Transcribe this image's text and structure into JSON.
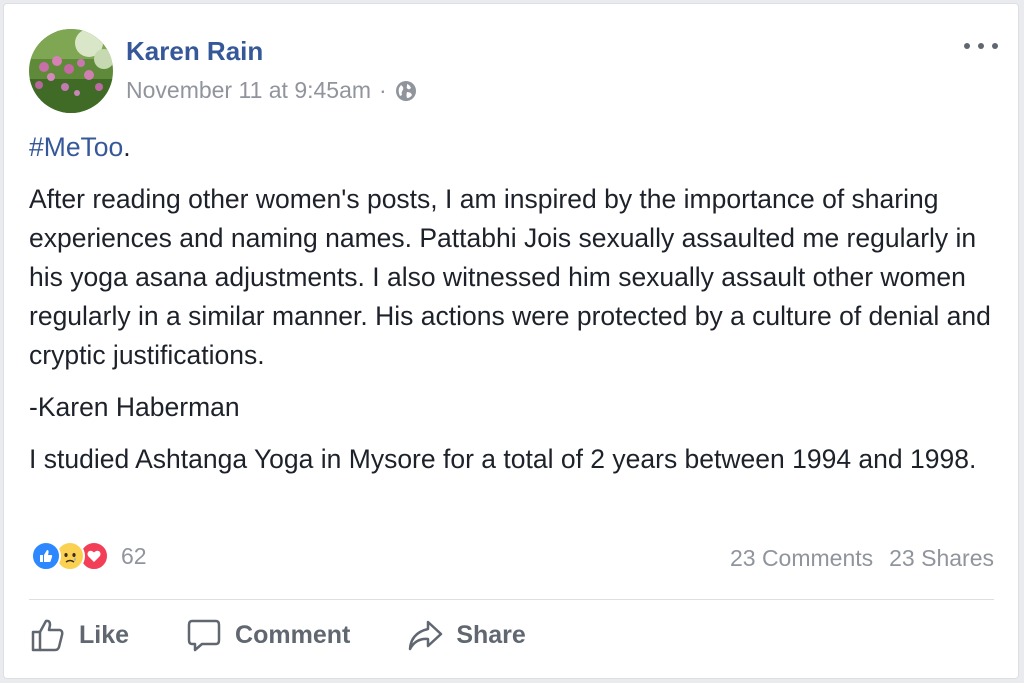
{
  "post": {
    "author": "Karen Rain",
    "timestamp": "November 11 at 9:45am",
    "separator": "·",
    "privacy_icon": "globe-icon",
    "hashtag": "#MeToo",
    "hashtag_suffix": ".",
    "paragraphs": [
      "After reading other women's posts, I am inspired by the importance of sharing experiences and naming names. Pattabhi Jois sexually assaulted me regularly in his yoga asana adjustments. I also witnessed him sexually assault other women regularly in a similar manner. His actions were protected by a culture of denial and cryptic justifications.",
      "-Karen Haberman",
      "I studied Ashtanga Yoga in Mysore for a total of 2 years between 1994 and 1998."
    ]
  },
  "reactions": {
    "icons": [
      "like-icon",
      "sad-icon",
      "love-icon"
    ],
    "count": "62",
    "comments": "23 Comments",
    "shares": "23 Shares"
  },
  "actions": {
    "like": "Like",
    "comment": "Comment",
    "share": "Share"
  },
  "colors": {
    "link": "#365899",
    "muted": "#90949c",
    "text": "#1d2129",
    "like_blue": "#2d88ff",
    "love_red": "#f33e58",
    "sad_yellow": "#fbd153"
  }
}
